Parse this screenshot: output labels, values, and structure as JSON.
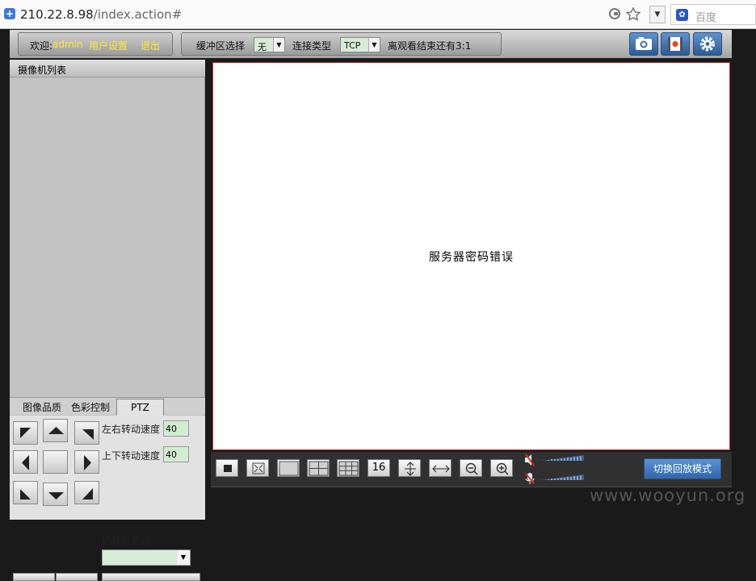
{
  "browser": {
    "url_host": "210.22.8.98",
    "url_path": "/index.action#",
    "search_placeholder": "百度",
    "home_icon": "shield-plus-icon"
  },
  "topbar": {
    "welcome": "欢迎:",
    "user": "admin",
    "user_settings": "用户设置",
    "logout": "退出",
    "buffer_label": "缓冲区选择",
    "buffer_value": "无",
    "conn_label": "连接类型",
    "conn_value": "TCP",
    "remain": "离观看结束还有3:1",
    "icons": [
      "camera-snapshot-icon",
      "record-video-icon",
      "settings-gear-icon"
    ]
  },
  "left": {
    "camera_list_title": "摄像机列表",
    "tabs": {
      "image_quality": "图像品质",
      "color_control": "色彩控制",
      "ptz": "PTZ"
    },
    "ptz": {
      "lr_speed_label": "左右转动速度",
      "lr_speed": "40",
      "ud_speed_label": "上下转动速度",
      "ud_speed": "40",
      "preset_label": "选择预置点:"
    }
  },
  "video": {
    "message": "服务器密码错误"
  },
  "controls": {
    "labels": {
      "sixteen": "16"
    },
    "playback_button": "切换回放模式"
  },
  "watermark": "www.wooyun.org",
  "colors": {
    "accent_blue": "#3b73b8",
    "error_border": "#c62a2a",
    "highlight_text": "#ffe632"
  }
}
